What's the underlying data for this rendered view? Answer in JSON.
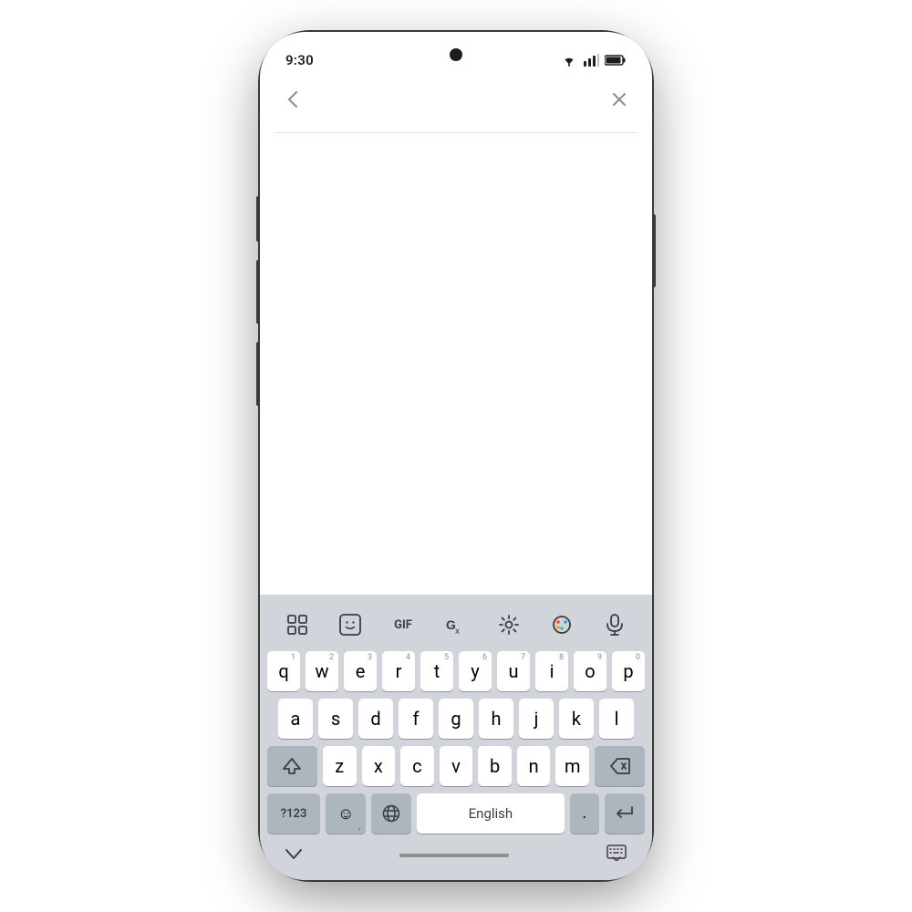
{
  "status_bar": {
    "time": "9:30",
    "battery_icon": "▲",
    "signal": "signal"
  },
  "nav": {
    "back_label": "‹",
    "close_label": "×"
  },
  "keyboard": {
    "toolbar": {
      "apps_label": "⊞",
      "emoji_sticker_label": "🙂",
      "gif_label": "GIF",
      "translate_label": "Gx",
      "settings_label": "⚙",
      "theme_label": "🎨",
      "mic_label": "🎙"
    },
    "rows": [
      {
        "keys": [
          {
            "letter": "q",
            "number": "1"
          },
          {
            "letter": "w",
            "number": "2"
          },
          {
            "letter": "e",
            "number": "3"
          },
          {
            "letter": "r",
            "number": "4"
          },
          {
            "letter": "t",
            "number": "5"
          },
          {
            "letter": "y",
            "number": "6"
          },
          {
            "letter": "u",
            "number": "7"
          },
          {
            "letter": "i",
            "number": "8"
          },
          {
            "letter": "o",
            "number": "9"
          },
          {
            "letter": "p",
            "number": "0"
          }
        ]
      },
      {
        "keys": [
          {
            "letter": "a"
          },
          {
            "letter": "s"
          },
          {
            "letter": "d"
          },
          {
            "letter": "f"
          },
          {
            "letter": "g"
          },
          {
            "letter": "h"
          },
          {
            "letter": "j"
          },
          {
            "letter": "k"
          },
          {
            "letter": "l"
          }
        ]
      },
      {
        "keys": [
          {
            "letter": "z"
          },
          {
            "letter": "x"
          },
          {
            "letter": "c"
          },
          {
            "letter": "v"
          },
          {
            "letter": "b"
          },
          {
            "letter": "n"
          },
          {
            "letter": "m"
          }
        ]
      }
    ],
    "bottom_row": {
      "symbols_label": "?123",
      "emoji_label": "☺",
      "globe_label": "🌐",
      "space_label": "English",
      "period_label": ".",
      "enter_label": "↵"
    },
    "bottom_bar": {
      "chevron_label": "˅",
      "keyboard_hide_label": "⌨"
    }
  }
}
